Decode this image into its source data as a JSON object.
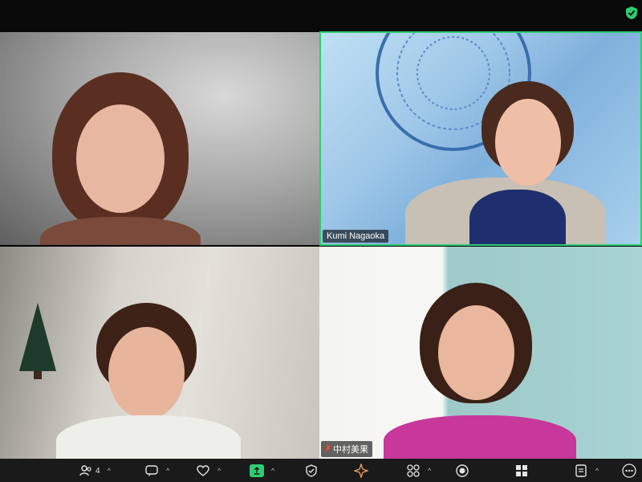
{
  "tiles": [
    {
      "name": "",
      "active": false
    },
    {
      "name": "Kumi Nagaoka",
      "active": true
    },
    {
      "name": "",
      "active": false
    },
    {
      "name": "中村美果",
      "active": false
    }
  ],
  "toolbar": {
    "participants_count": "4",
    "buttons": [
      "participants-icon",
      "chat-icon",
      "reactions-icon",
      "share-screen-icon",
      "security-icon",
      "ai-companion-icon",
      "apps-icon",
      "record-icon",
      "view-icon",
      "notes-icon",
      "more-icon"
    ]
  },
  "colors": {
    "active_border": "#2ecc71",
    "share_button": "#2ecc71",
    "toolbar_bg": "#1a1a1a"
  }
}
